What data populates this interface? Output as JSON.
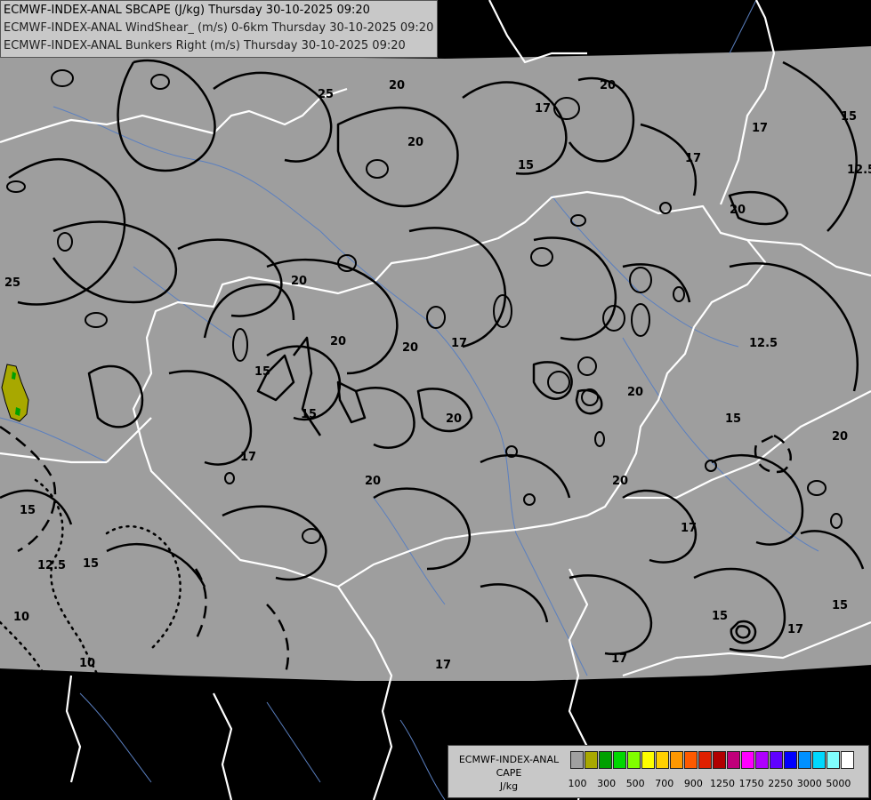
{
  "header": {
    "line1": "ECMWF-INDEX-ANAL SBCAPE (J/kg) Thursday 30-10-2025 09:20",
    "line2": "ECMWF-INDEX-ANAL WindShear_ (m/s) 0-6km Thursday 30-10-2025 09:20",
    "line3": "ECMWF-INDEX-ANAL Bunkers Right (m/s) Thursday 30-10-2025 09:20"
  },
  "legend": {
    "title_line1": "ECMWF-INDEX-ANAL",
    "title_line2": "CAPE",
    "title_line3": "J/kg",
    "colors": [
      "#a0a0a0",
      "#a8a800",
      "#00a000",
      "#00d800",
      "#80ff00",
      "#ffff00",
      "#ffd000",
      "#ff9800",
      "#ff5a00",
      "#e02000",
      "#b00000",
      "#c0007a",
      "#ff00ff",
      "#b000ff",
      "#6000ff",
      "#0000ff",
      "#0090ff",
      "#00d8ff",
      "#80ffff",
      "#ffffff"
    ],
    "tick_labels": [
      "100",
      "300",
      "500",
      "700",
      "900",
      "1250",
      "1750",
      "2250",
      "3000",
      "5000"
    ]
  },
  "map": {
    "field_color": "#9e9e9e",
    "background_color": "#000000",
    "border_color": "#ffffff",
    "river_color": "#5a7fc0",
    "contour_color": "#000000",
    "cape_patch_color": "#a8a800",
    "cape_core_color": "#00a000",
    "contour_labels": [
      "25",
      "20",
      "20",
      "17",
      "15",
      "17",
      "12.5",
      "15",
      "17",
      "20",
      "20",
      "25",
      "20",
      "17",
      "20",
      "15",
      "20",
      "20",
      "15",
      "17",
      "20",
      "20",
      "20",
      "15",
      "20",
      "17",
      "15",
      "17",
      "15",
      "17",
      "17",
      "12.5",
      "15",
      "10",
      "10",
      "15",
      "12.5"
    ]
  }
}
